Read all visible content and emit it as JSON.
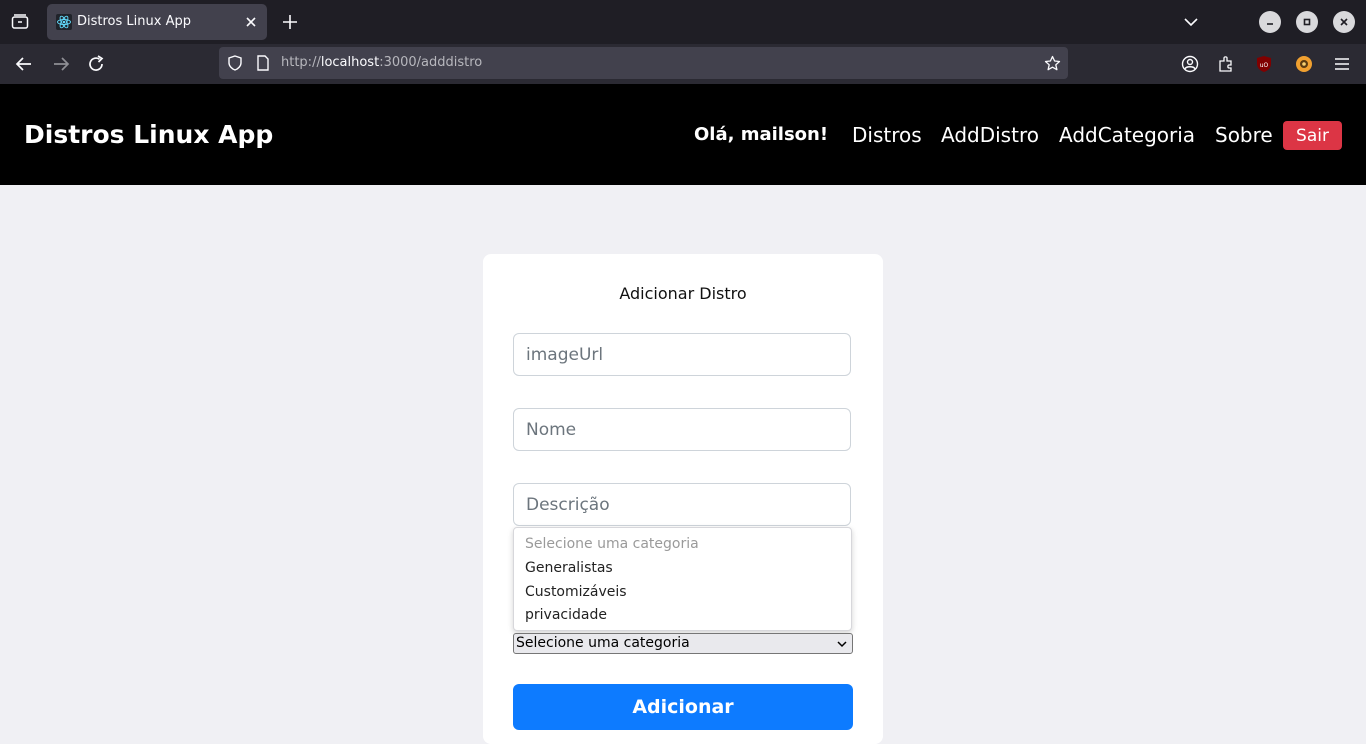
{
  "browser": {
    "tab_title": "Distros Linux App",
    "url_prefix": "http://",
    "url_host": "localhost",
    "url_rest": ":3000/adddistro"
  },
  "header": {
    "brand": "Distros Linux App",
    "greeting": "Olá, mailson!",
    "nav": [
      "Distros",
      "AddDistro",
      "AddCategoria",
      "Sobre"
    ],
    "logout_label": "Sair"
  },
  "form": {
    "title": "Adicionar Distro",
    "image_placeholder": "imageUrl",
    "name_placeholder": "Nome",
    "description_placeholder": "Descrição",
    "category_options": [
      "Selecione uma categoria",
      "Generalistas",
      "Customizáveis",
      "privacidade"
    ],
    "category_selected": "Selecione uma categoria",
    "submit_label": "Adicionar"
  },
  "colors": {
    "header_bg": "#000000",
    "logout_bg": "#dc3545",
    "submit_bg": "#0d7bff",
    "page_bg": "#f0f0f4"
  }
}
